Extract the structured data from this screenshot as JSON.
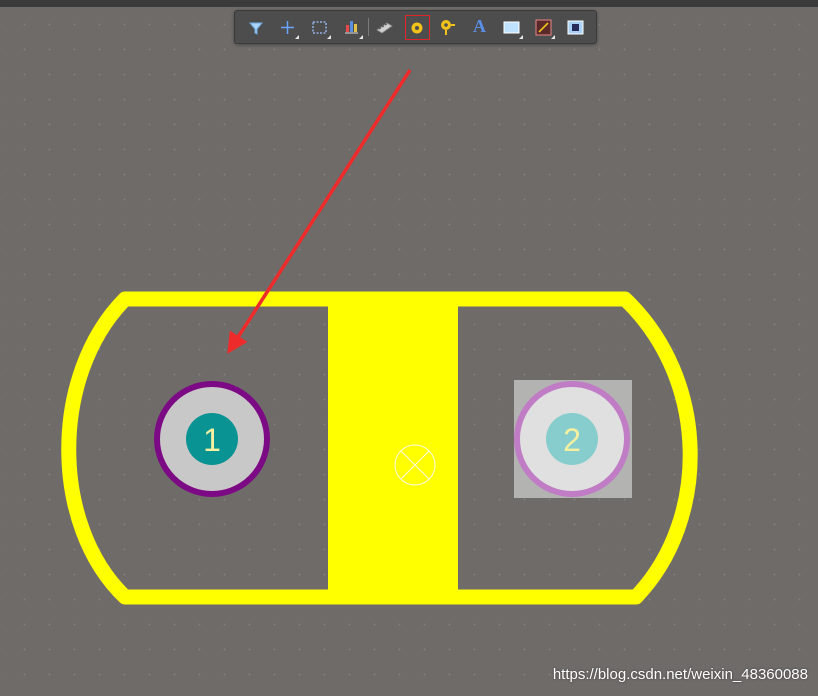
{
  "toolbar": {
    "buttons": [
      {
        "icon": "filter-icon",
        "has_menu": false,
        "selected": false
      },
      {
        "icon": "crosshair-icon",
        "has_menu": true,
        "selected": false
      },
      {
        "icon": "select-rectangle-icon",
        "has_menu": true,
        "selected": false
      },
      {
        "icon": "align-icon",
        "has_menu": true,
        "selected": false
      },
      {
        "icon": "component-icon",
        "has_menu": false,
        "selected": false
      },
      {
        "icon": "place-pad-icon",
        "has_menu": false,
        "selected": true
      },
      {
        "icon": "place-via-icon",
        "has_menu": false,
        "selected": false
      },
      {
        "icon": "place-string-icon",
        "has_menu": false,
        "selected": false
      },
      {
        "icon": "place-fill-icon",
        "has_menu": true,
        "selected": false
      },
      {
        "icon": "place-line-icon",
        "has_menu": true,
        "selected": false
      },
      {
        "icon": "place-region-icon",
        "has_menu": false,
        "selected": false
      }
    ],
    "string_glyph": "A"
  },
  "footprint": {
    "pads": [
      {
        "designator": "1",
        "state": "normal"
      },
      {
        "designator": "2",
        "state": "selected"
      }
    ]
  },
  "colors": {
    "background": "#6f6b69",
    "overlay_yellow": "#ffff00",
    "pad_ring": "#e0e0e0",
    "pad_1_outline": "#7d0a85",
    "pad_1_hole": "#0a9393",
    "pad_2_outline": "#c07cc4",
    "pad_2_hole": "#87cdcd",
    "designator_text": "#f5f0a0",
    "annotation_arrow": "#ee2b2b"
  },
  "watermark": "https://blog.csdn.net/weixin_48360088"
}
